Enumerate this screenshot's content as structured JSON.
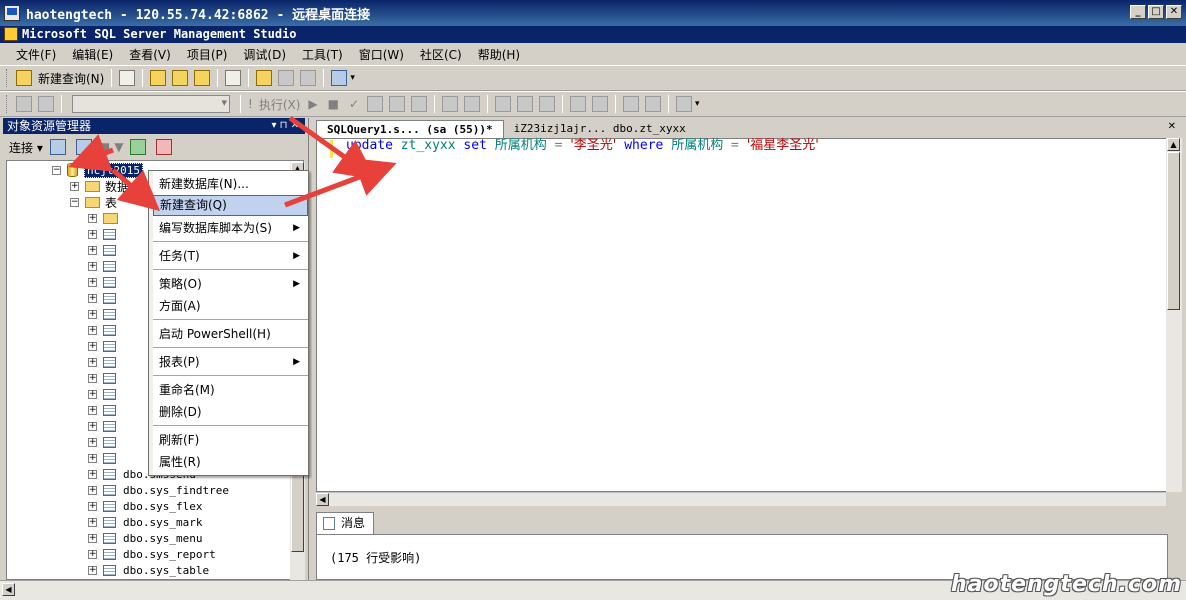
{
  "rdp": {
    "title": "haotengtech - 120.55.74.42:6862 - 远程桌面连接",
    "min": "_",
    "max": "□",
    "close": "✕"
  },
  "app": {
    "title": "Microsoft SQL Server Management Studio"
  },
  "menu": [
    "文件(F)",
    "编辑(E)",
    "查看(V)",
    "项目(P)",
    "调试(D)",
    "工具(T)",
    "窗口(W)",
    "社区(C)",
    "帮助(H)"
  ],
  "toolbar1": {
    "new_query": "新建查询(N)"
  },
  "toolbar2": {
    "execute": "执行(X)"
  },
  "object_explorer": {
    "title": "对象资源管理器",
    "pin": "▾ ⊓ ✕",
    "connect": "连接 ▾",
    "tree": {
      "database": "hcjt2015",
      "child1": "数据",
      "tables": "表",
      "tables_visible": [
        "dbo.smssend",
        "dbo.sys_findtree",
        "dbo.sys_flex",
        "dbo.sys_mark",
        "dbo.sys_menu",
        "dbo.sys_report",
        "dbo.sys_table"
      ]
    }
  },
  "context_menu": {
    "items": [
      {
        "label": "新建数据库(N)..."
      },
      {
        "label": "新建查询(Q)"
      },
      {
        "label": "编写数据库脚本为(S)"
      },
      {
        "label": "任务(T)"
      },
      {
        "label": "策略(O)"
      },
      {
        "label": "方面(A)"
      },
      {
        "label": "启动 PowerShell(H)"
      },
      {
        "label": "报表(P)"
      },
      {
        "label": "重命名(M)"
      },
      {
        "label": "删除(D)"
      },
      {
        "label": "刷新(F)"
      },
      {
        "label": "属性(R)"
      }
    ],
    "submenu_arrow": "▶"
  },
  "editor": {
    "tab_active": "SQLQuery1.s... (sa (55))*",
    "tab_inactive": "iZ23izj1ajr... dbo.zt_xyxx",
    "tab_close": "✕",
    "sql": {
      "kw1": "update",
      "table": "zt_xyxx",
      "kw2": "set",
      "col1": "所属机构",
      "eq1": "=",
      "val1": "'李圣光'",
      "kw3": "where",
      "col2": "所属机构",
      "eq2": "=",
      "val2": "'福星李圣光'"
    }
  },
  "results": {
    "tab": "消息",
    "message": "(175 行受影响)"
  },
  "watermark": "haotengtech.com"
}
